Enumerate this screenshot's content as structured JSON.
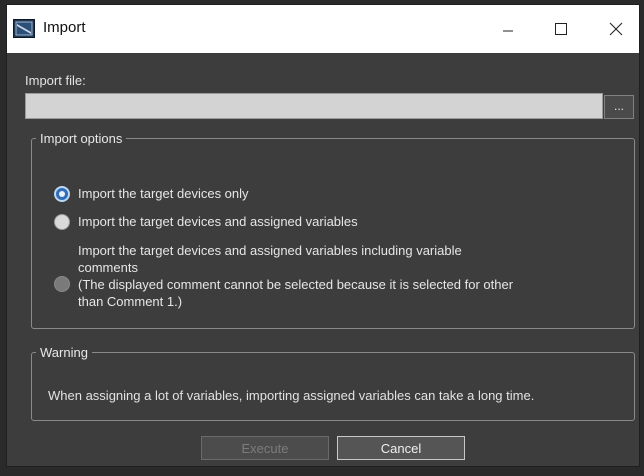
{
  "window": {
    "title": "Import"
  },
  "titlebar_buttons": {
    "minimize": "minimize-icon",
    "maximize": "maximize-icon",
    "close": "close-icon"
  },
  "import_file": {
    "label": "Import file:",
    "value": "",
    "browse_label": "..."
  },
  "import_options": {
    "legend": "Import options",
    "options": [
      {
        "label": "Import the target devices only",
        "checked": true,
        "enabled": true
      },
      {
        "label": "Import the target devices and assigned variables",
        "checked": false,
        "enabled": true
      },
      {
        "label_line1": "Import the target devices and assigned variables including variable",
        "label_line2": "comments",
        "label_line3": "(The displayed comment cannot be selected because it is selected for other",
        "label_line4": "than Comment 1.)",
        "checked": false,
        "enabled": false
      }
    ]
  },
  "warning": {
    "legend": "Warning",
    "text": "When assigning a lot of variables, importing assigned variables can take a long time."
  },
  "buttons": {
    "execute": {
      "label": "Execute",
      "enabled": false
    },
    "cancel": {
      "label": "Cancel",
      "enabled": true
    }
  },
  "colors": {
    "dialog_background": "#3d3d3d",
    "titlebar": "#ffffff",
    "radio_selected": "#2f6db7"
  }
}
